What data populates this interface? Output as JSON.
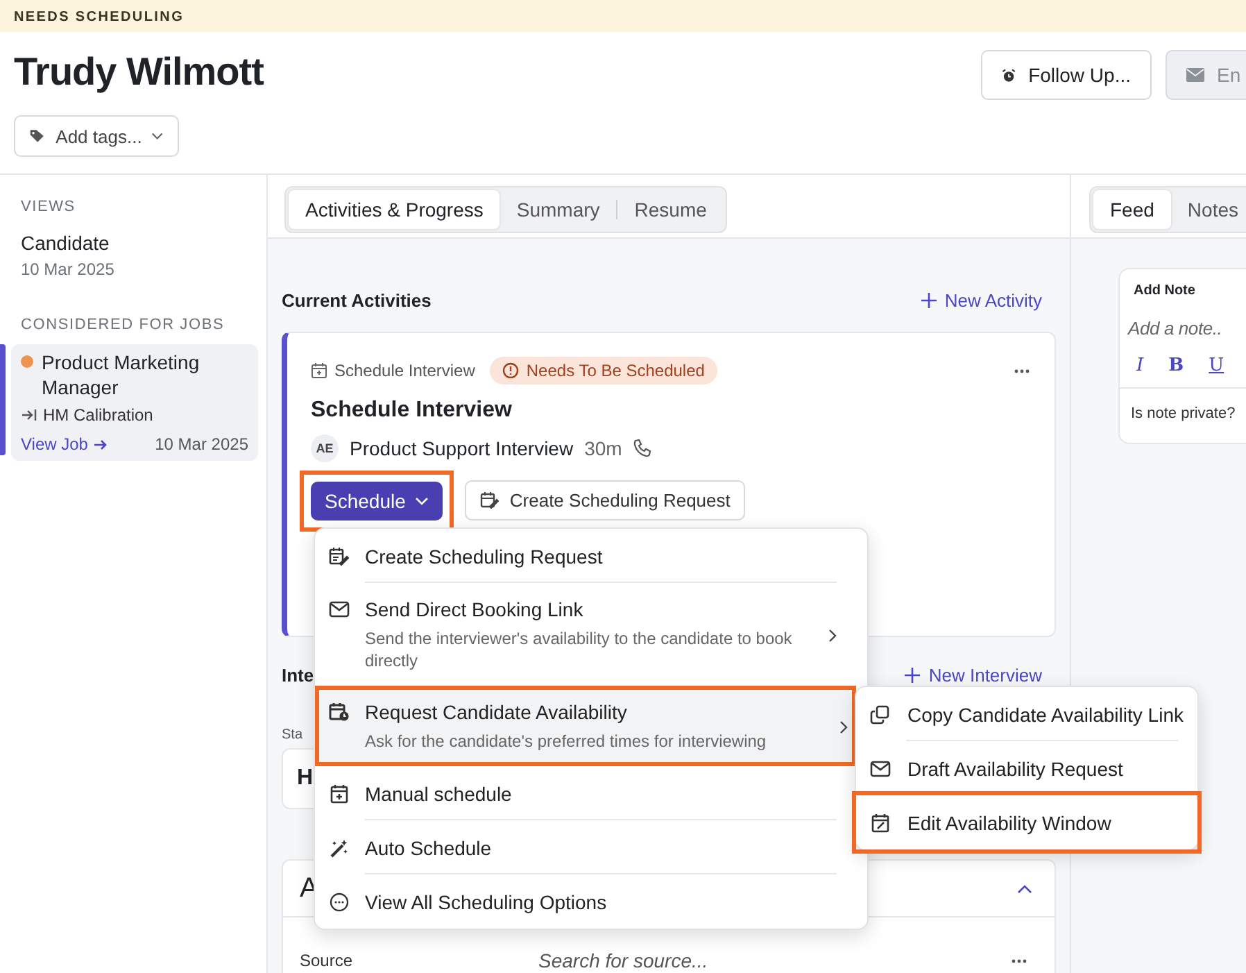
{
  "banner": {
    "label": "NEEDS SCHEDULING"
  },
  "candidate": {
    "name": "Trudy Wilmott"
  },
  "header_actions": [
    {
      "label": "Follow Up..."
    },
    {
      "label": "En"
    }
  ],
  "tags": {
    "placeholder": "Add tags..."
  },
  "sidebar": {
    "views_heading": "VIEWS",
    "views": [
      {
        "title": "Candidate",
        "date": "10 Mar 2025"
      }
    ],
    "jobs_heading": "CONSIDERED FOR JOBS",
    "jobs": [
      {
        "title": "Product Marketing Manager",
        "color": "#ef9350",
        "stage": "HM Calibration",
        "link": "View Job",
        "date": "10 Mar 2025",
        "selected": true
      }
    ]
  },
  "tabs": [
    {
      "label": "Activities & Progress",
      "selected": true
    },
    {
      "label": "Summary",
      "selected": false
    },
    {
      "label": "Resume",
      "selected": false
    }
  ],
  "current_activities": {
    "heading": "Current Activities",
    "action": "New Activity"
  },
  "activity": {
    "type": "Schedule Interview",
    "status": "Needs To Be Scheduled",
    "title": "Schedule Interview",
    "avatar": "AE",
    "interview": "Product Support Interview",
    "duration": "30m",
    "primary_button": {
      "label": "Schedule",
      "highlighted": true
    },
    "secondary_button": {
      "label": "Create Scheduling Request"
    }
  },
  "interviews": {
    "heading": "Inte",
    "action": "New Interview",
    "field_label": "Sta",
    "card_text": "H"
  },
  "section": {
    "heading": "A",
    "expanded": true,
    "source_label": "Source",
    "source_placeholder": "Search for source..."
  },
  "schedule_menu": [
    {
      "label": "Create Scheduling Request",
      "selected": false,
      "highlighted": false,
      "has_submenu": false
    },
    {
      "label": "Send Direct Booking Link",
      "description": "Send the interviewer's availability to the candidate to book directly",
      "selected": false,
      "highlighted": false,
      "has_submenu": true
    },
    {
      "label": "Request Candidate Availability",
      "description": "Ask for the candidate's preferred times for interviewing",
      "selected": true,
      "highlighted": true,
      "has_submenu": true
    },
    {
      "label": "Manual schedule",
      "selected": false,
      "highlighted": false,
      "has_submenu": false
    },
    {
      "label": "Auto Schedule",
      "selected": false,
      "highlighted": false,
      "has_submenu": false
    },
    {
      "label": "View All Scheduling Options",
      "selected": false,
      "highlighted": false,
      "has_submenu": false
    }
  ],
  "submenu": [
    {
      "label": "Copy Candidate Availability Link",
      "highlighted": false
    },
    {
      "label": "Draft Availability Request",
      "highlighted": false
    },
    {
      "label": "Edit Availability Window",
      "highlighted": true
    }
  ],
  "right_tabs": [
    {
      "label": "Feed",
      "selected": true
    },
    {
      "label": "Notes",
      "selected": false
    }
  ],
  "note": {
    "heading": "Add Note",
    "placeholder": "Add a note..",
    "format_buttons": [
      "I",
      "B",
      "U"
    ],
    "private_label": "Is note private?"
  }
}
